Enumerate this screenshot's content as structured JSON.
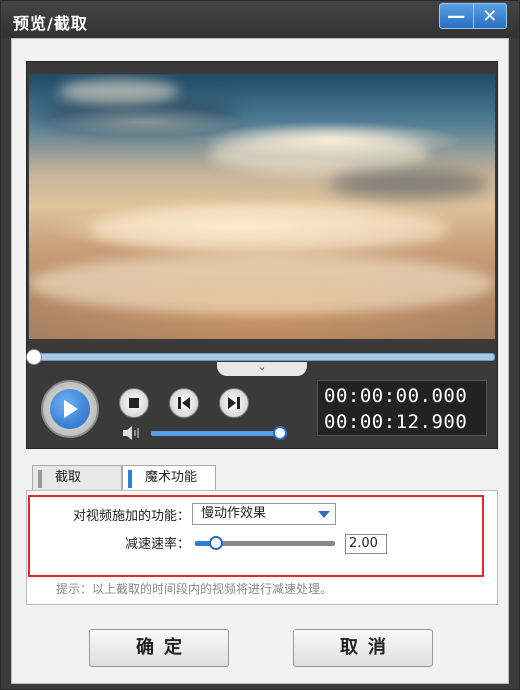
{
  "window": {
    "title": "预览/截取",
    "minimize_symbol": "—",
    "close_symbol": "✕"
  },
  "player": {
    "current_time": "00:00:00.000",
    "total_time": "00:00:12.900",
    "playback_progress": 0.0,
    "volume_level": 0.95,
    "collapse_symbol": "⌄"
  },
  "tabs": [
    {
      "label": "截取",
      "active": false
    },
    {
      "label": "魔术功能",
      "active": true
    }
  ],
  "magic": {
    "effect_label": "对视频施加的功能：",
    "effect_value": "慢动作效果",
    "rate_label": "减速速率：",
    "rate_value": "2.00",
    "rate_slider_level": 0.15,
    "hint": "提示：以上截取的时间段内的视频将进行减速处理。"
  },
  "buttons": {
    "ok": "确定",
    "cancel": "取消"
  },
  "colors": {
    "accent": "#2a7fd4",
    "highlight_border": "#e0282e"
  }
}
